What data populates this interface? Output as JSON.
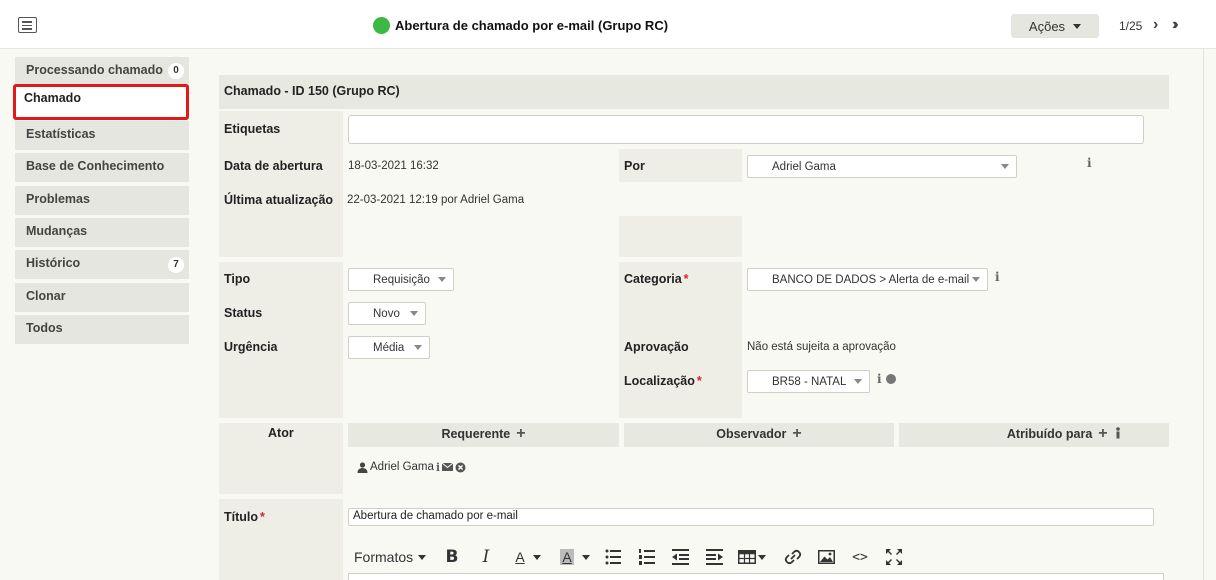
{
  "header": {
    "ticket_title": "Abertura de chamado por e-mail (Grupo RC)",
    "status_color": "#3cb844",
    "actions_label": "Ações",
    "pager": "1/25"
  },
  "tabs": [
    {
      "label": "Processando chamado",
      "badge": "0"
    },
    {
      "label": "Chamado",
      "active": true
    },
    {
      "label": "Estatísticas"
    },
    {
      "label": "Base de Conhecimento"
    },
    {
      "label": "Problemas"
    },
    {
      "label": "Mudanças"
    },
    {
      "label": "Histórico",
      "badge": "7"
    },
    {
      "label": "Clonar"
    },
    {
      "label": "Todos"
    }
  ],
  "form": {
    "section_title": "Chamado - ID 150 (Grupo RC)",
    "tags_label": "Etiquetas",
    "opening_date_label": "Data de abertura",
    "opening_date": "18-03-2021 16:32",
    "by_label": "Por",
    "by_value": "Adriel Gama",
    "last_update_label": "Última atualização",
    "last_update": "22-03-2021 12:19 por Adriel Gama",
    "type_label": "Tipo",
    "type_value": "Requisição",
    "category_label": "Categoria",
    "category_value": "BANCO DE DADOS > Alerta de e-mail",
    "status_label": "Status",
    "status_value": "Novo",
    "urgency_label": "Urgência",
    "urgency_value": "Média",
    "approval_label": "Aprovação",
    "approval_value": "Não está sujeita a aprovação",
    "location_label": "Localização",
    "location_value": "BR58 - NATAL",
    "required_mark": "*",
    "info_glyph": "i"
  },
  "actors": {
    "actor_label": "Ator",
    "requester_label": "Requerente",
    "observer_label": "Observador",
    "assigned_label": "Atribuído para",
    "requester_name": "Adriel Gama",
    "plus_glyph": "+"
  },
  "title_field": {
    "label": "Título",
    "value": "Abertura de chamado por e-mail"
  },
  "editor_toolbar": {
    "formats_label": "Formatos",
    "bold": "B",
    "italic": "I",
    "text_color": "A",
    "bg_color": "A",
    "code": "<>"
  }
}
